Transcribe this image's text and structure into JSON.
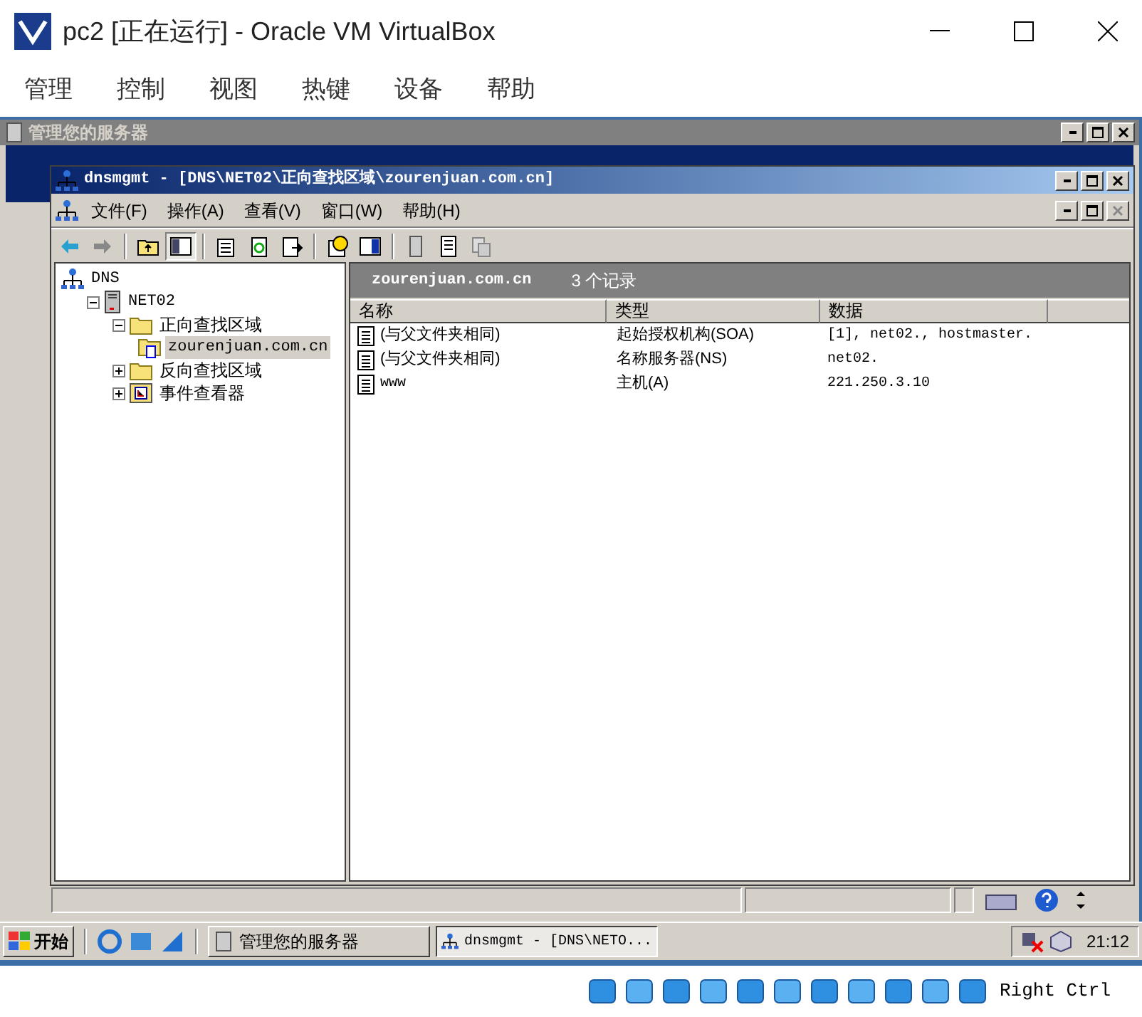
{
  "host_window": {
    "title": "pc2 [正在运行] - Oracle VM VirtualBox",
    "menu": [
      "管理",
      "控制",
      "视图",
      "热键",
      "设备",
      "帮助"
    ]
  },
  "back_window": {
    "title": "管理您的服务器"
  },
  "mmc_window": {
    "title": "dnsmgmt - [DNS\\NET02\\正向查找区域\\zourenjuan.com.cn]",
    "menu": [
      "文件(F)",
      "操作(A)",
      "查看(V)",
      "窗口(W)",
      "帮助(H)"
    ],
    "tree": [
      {
        "label": "DNS",
        "kind": "dns",
        "selected": false,
        "children": [
          {
            "label": "NET02",
            "kind": "server",
            "expanded": true,
            "selected": false,
            "children": [
              {
                "label": "正向查找区域",
                "kind": "folder",
                "expanded": true,
                "selected": false,
                "children": [
                  {
                    "label": "zourenjuan.com.cn",
                    "kind": "zone",
                    "selected": true
                  }
                ]
              },
              {
                "label": "反向查找区域",
                "kind": "folder",
                "expanded": false,
                "selected": false
              },
              {
                "label": "事件查看器",
                "kind": "events",
                "expanded": false,
                "selected": false
              }
            ]
          }
        ]
      }
    ],
    "header": {
      "zone": "zourenjuan.com.cn",
      "count": "3 个记录"
    },
    "columns": [
      "名称",
      "类型",
      "数据"
    ],
    "rows": [
      {
        "name": "(与父文件夹相同)",
        "type": "起始授权机构(SOA)",
        "data": "[1], net02., hostmaster."
      },
      {
        "name": "(与父文件夹相同)",
        "type": "名称服务器(NS)",
        "data": "net02."
      },
      {
        "name": "www",
        "type": "主机(A)",
        "data": "221.250.3.10"
      }
    ]
  },
  "taskbar": {
    "start": "开始",
    "tasks": [
      {
        "label": "管理您的服务器",
        "selected": false
      },
      {
        "label": "dnsmgmt - [DNS\\NETO...",
        "selected": true
      }
    ],
    "clock": "21:12"
  },
  "host_status": {
    "host_key": "Right Ctrl"
  }
}
